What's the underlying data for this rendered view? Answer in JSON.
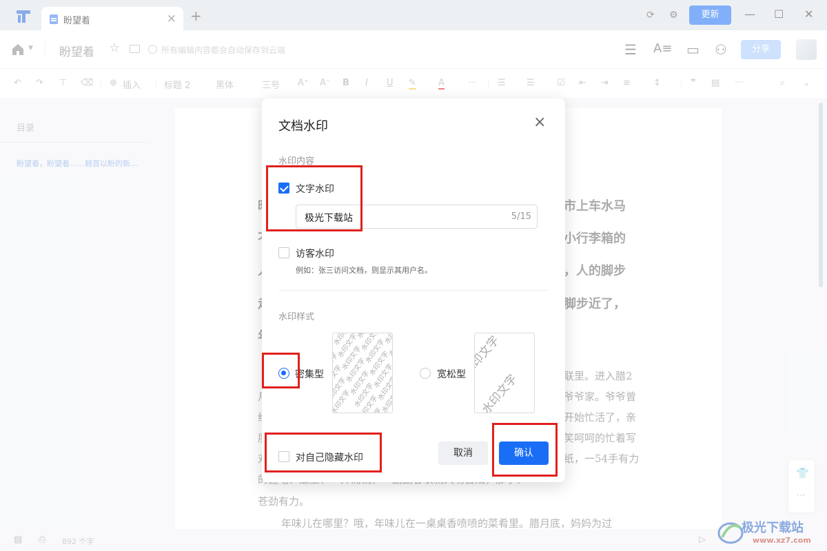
{
  "titlebar": {
    "tab_title": "盼望着",
    "tab_close": "×",
    "tab_add": "+",
    "update_label": "更新"
  },
  "header": {
    "doc_title": "盼望着",
    "save_status": "所有编辑内容都会自动保存到云端",
    "share_label": "分享"
  },
  "format_toolbar": {
    "insert": "插入",
    "heading": "标题 2",
    "font": "黑体",
    "size": "三号",
    "more": "···"
  },
  "sidebar": {
    "toc_title": "目录",
    "toc_item": "盼望着，盼望着……翘首以盼的新..."
  },
  "document": {
    "bold_lines": [
      "昨",
      "市上车水马",
      "不",
      "小行李箱的",
      "人",
      "，人的脚步",
      "走",
      "脚步近了，",
      "年"
    ],
    "body_lines": [
      "联里。进入腊2",
      "月",
      "爷爷家。爷爷曾",
      "经",
      "开始忙活了，亲",
      "朋",
      "笑呵呵的忙着写",
      "对",
      "纸，一54手有力",
      "的握笔、蘸墨、一挥而就，一副副春联就大功告成，那字，",
      "苍劲有力。",
      "年味儿在哪里？哦，年味儿在一桌桌香喷喷的菜肴里。腊月底，妈妈为过"
    ]
  },
  "statusbar": {
    "word_count": "892 个字",
    "watermark_site": "极光下载站",
    "watermark_url": "www.xz7.com"
  },
  "dialog": {
    "title": "文档水印",
    "close": "×",
    "section_content": "水印内容",
    "text_watermark_label": "文字水印",
    "text_watermark_checked": true,
    "text_watermark_value": "极光下载站",
    "char_count": "5/15",
    "visitor_watermark_label": "访客水印",
    "visitor_watermark_checked": false,
    "visitor_hint": "例如：张三访问文档，则显示其用户名。",
    "section_style": "水印样式",
    "style_dense_label": "密集型",
    "style_loose_label": "宽松型",
    "preview_text": "水印文字",
    "selected_style": "密集型",
    "hide_self_label": "对自己隐藏水印",
    "hide_self_checked": false,
    "cancel_label": "取消",
    "confirm_label": "确认"
  },
  "colors": {
    "accent": "#1a6ef5",
    "highlight": "#e0201e",
    "share_disabled": "#a6c8fb"
  }
}
